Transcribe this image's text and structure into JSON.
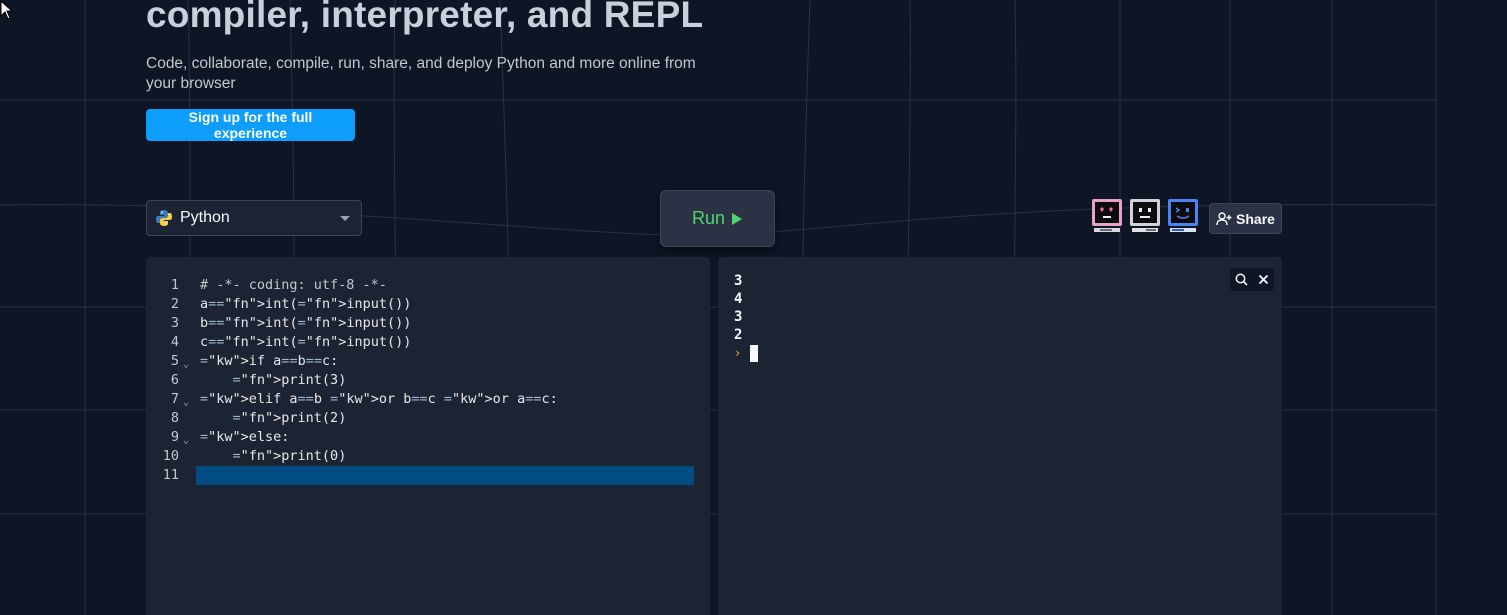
{
  "hero": {
    "title": "compiler, interpreter, and REPL",
    "subtitle": "Code, collaborate, compile, run, share, and deploy Python and more online from your browser",
    "signup_label": "Sign up for the full experience"
  },
  "toolbar": {
    "language": "Python",
    "run_label": "Run",
    "share_label": "Share",
    "icons": {
      "language": "python-icon",
      "caret": "chevron-down-icon",
      "run": "play-icon",
      "share": "add-user-icon"
    },
    "avatars": [
      {
        "name": "avatar-heart-eyes",
        "frame_color": "#e8a2c8"
      },
      {
        "name": "avatar-neutral",
        "frame_color": "#d0d4d8"
      },
      {
        "name": "avatar-wink",
        "frame_color": "#4b84f0"
      }
    ]
  },
  "editor": {
    "lines": [
      {
        "n": "1",
        "fold": "",
        "text": "# -*- coding: utf-8 -*-"
      },
      {
        "n": "2",
        "fold": "",
        "text": "a=int(input())"
      },
      {
        "n": "3",
        "fold": "",
        "text": "b=int(input())"
      },
      {
        "n": "4",
        "fold": "",
        "text": "c=int(input())"
      },
      {
        "n": "5",
        "fold": "⌄",
        "text": "if a==b==c:"
      },
      {
        "n": "6",
        "fold": "",
        "text": "    print(3)"
      },
      {
        "n": "7",
        "fold": "⌄",
        "text": "elif a==b or b==c or a==c:"
      },
      {
        "n": "8",
        "fold": "",
        "text": "    print(2)"
      },
      {
        "n": "9",
        "fold": "⌄",
        "text": "else:"
      },
      {
        "n": "10",
        "fold": "",
        "text": "    print(0)"
      },
      {
        "n": "11",
        "fold": "",
        "text": ""
      }
    ],
    "active_line": "11"
  },
  "console": {
    "output": [
      "3",
      "4",
      "3",
      "2"
    ],
    "prompt": "›",
    "icons": {
      "search": "search-icon",
      "clear": "close-icon"
    }
  },
  "colors": {
    "background": "#0e1525",
    "panel": "#1c2333",
    "accent": "#0d9dfd",
    "run_green": "#4fd669",
    "keyword": "#56a0f5",
    "function": "#e9d785",
    "prompt": "#f5b827",
    "selection": "#004b82"
  }
}
